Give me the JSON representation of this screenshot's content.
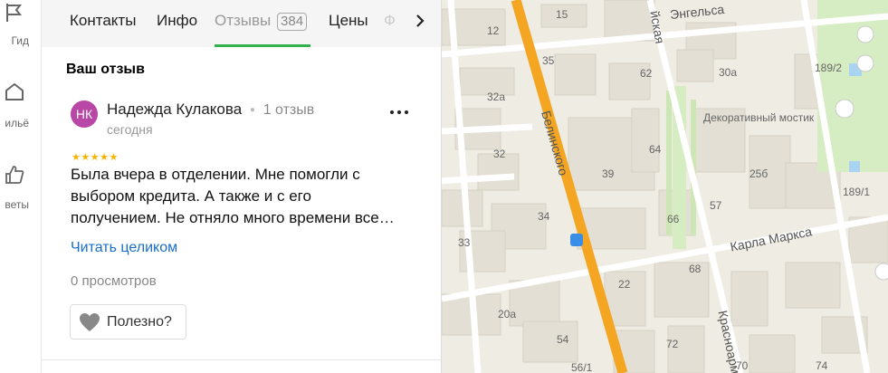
{
  "rail": {
    "items": [
      {
        "label": "Гид",
        "icon": "guide-icon"
      },
      {
        "label": "ильё",
        "icon": "housing-icon"
      },
      {
        "label": "веты",
        "icon": "thumbs-up-icon"
      }
    ]
  },
  "tabs": {
    "contacts": "Контакты",
    "info": "Инфо",
    "reviews": "Отзывы",
    "reviews_count": "384",
    "prices": "Цены",
    "faded": "Ф"
  },
  "review_section": {
    "title": "Ваш отзыв",
    "avatar_initials": "НК",
    "author": "Надежда Кулакова",
    "author_reviews": "1 отзыв",
    "date": "сегодня",
    "rating": 5,
    "stars_text": "★★★★★",
    "text": "Была вчера в отделении. Мне помогли с выбором кредита. А также и с его получением. Не отняло много времени все…",
    "read_more": "Читать целиком",
    "views": "0 просмотров",
    "useful_button": "Полезно?"
  },
  "map": {
    "streets": {
      "engelsa": "Энгельса",
      "belinskogo": "Белинского",
      "karla_marksa": "Карла Маркса",
      "krasnoarm": "Красноарм",
      "yskaya": "йская"
    },
    "poi": "Декоративный мостик",
    "house_numbers": [
      "12",
      "15",
      "35",
      "62",
      "32а",
      "30а",
      "189/2",
      "32",
      "39",
      "64",
      "25б",
      "189/1",
      "34",
      "66",
      "57",
      "33",
      "68",
      "22",
      "20а",
      "54",
      "72",
      "56/1",
      "70",
      "74"
    ]
  },
  "colors": {
    "accent_green": "#32b24c",
    "link_blue": "#1a6ec8",
    "avatar": "#b847a6",
    "star": "#f4b400",
    "road_orange": "#f4a623"
  }
}
